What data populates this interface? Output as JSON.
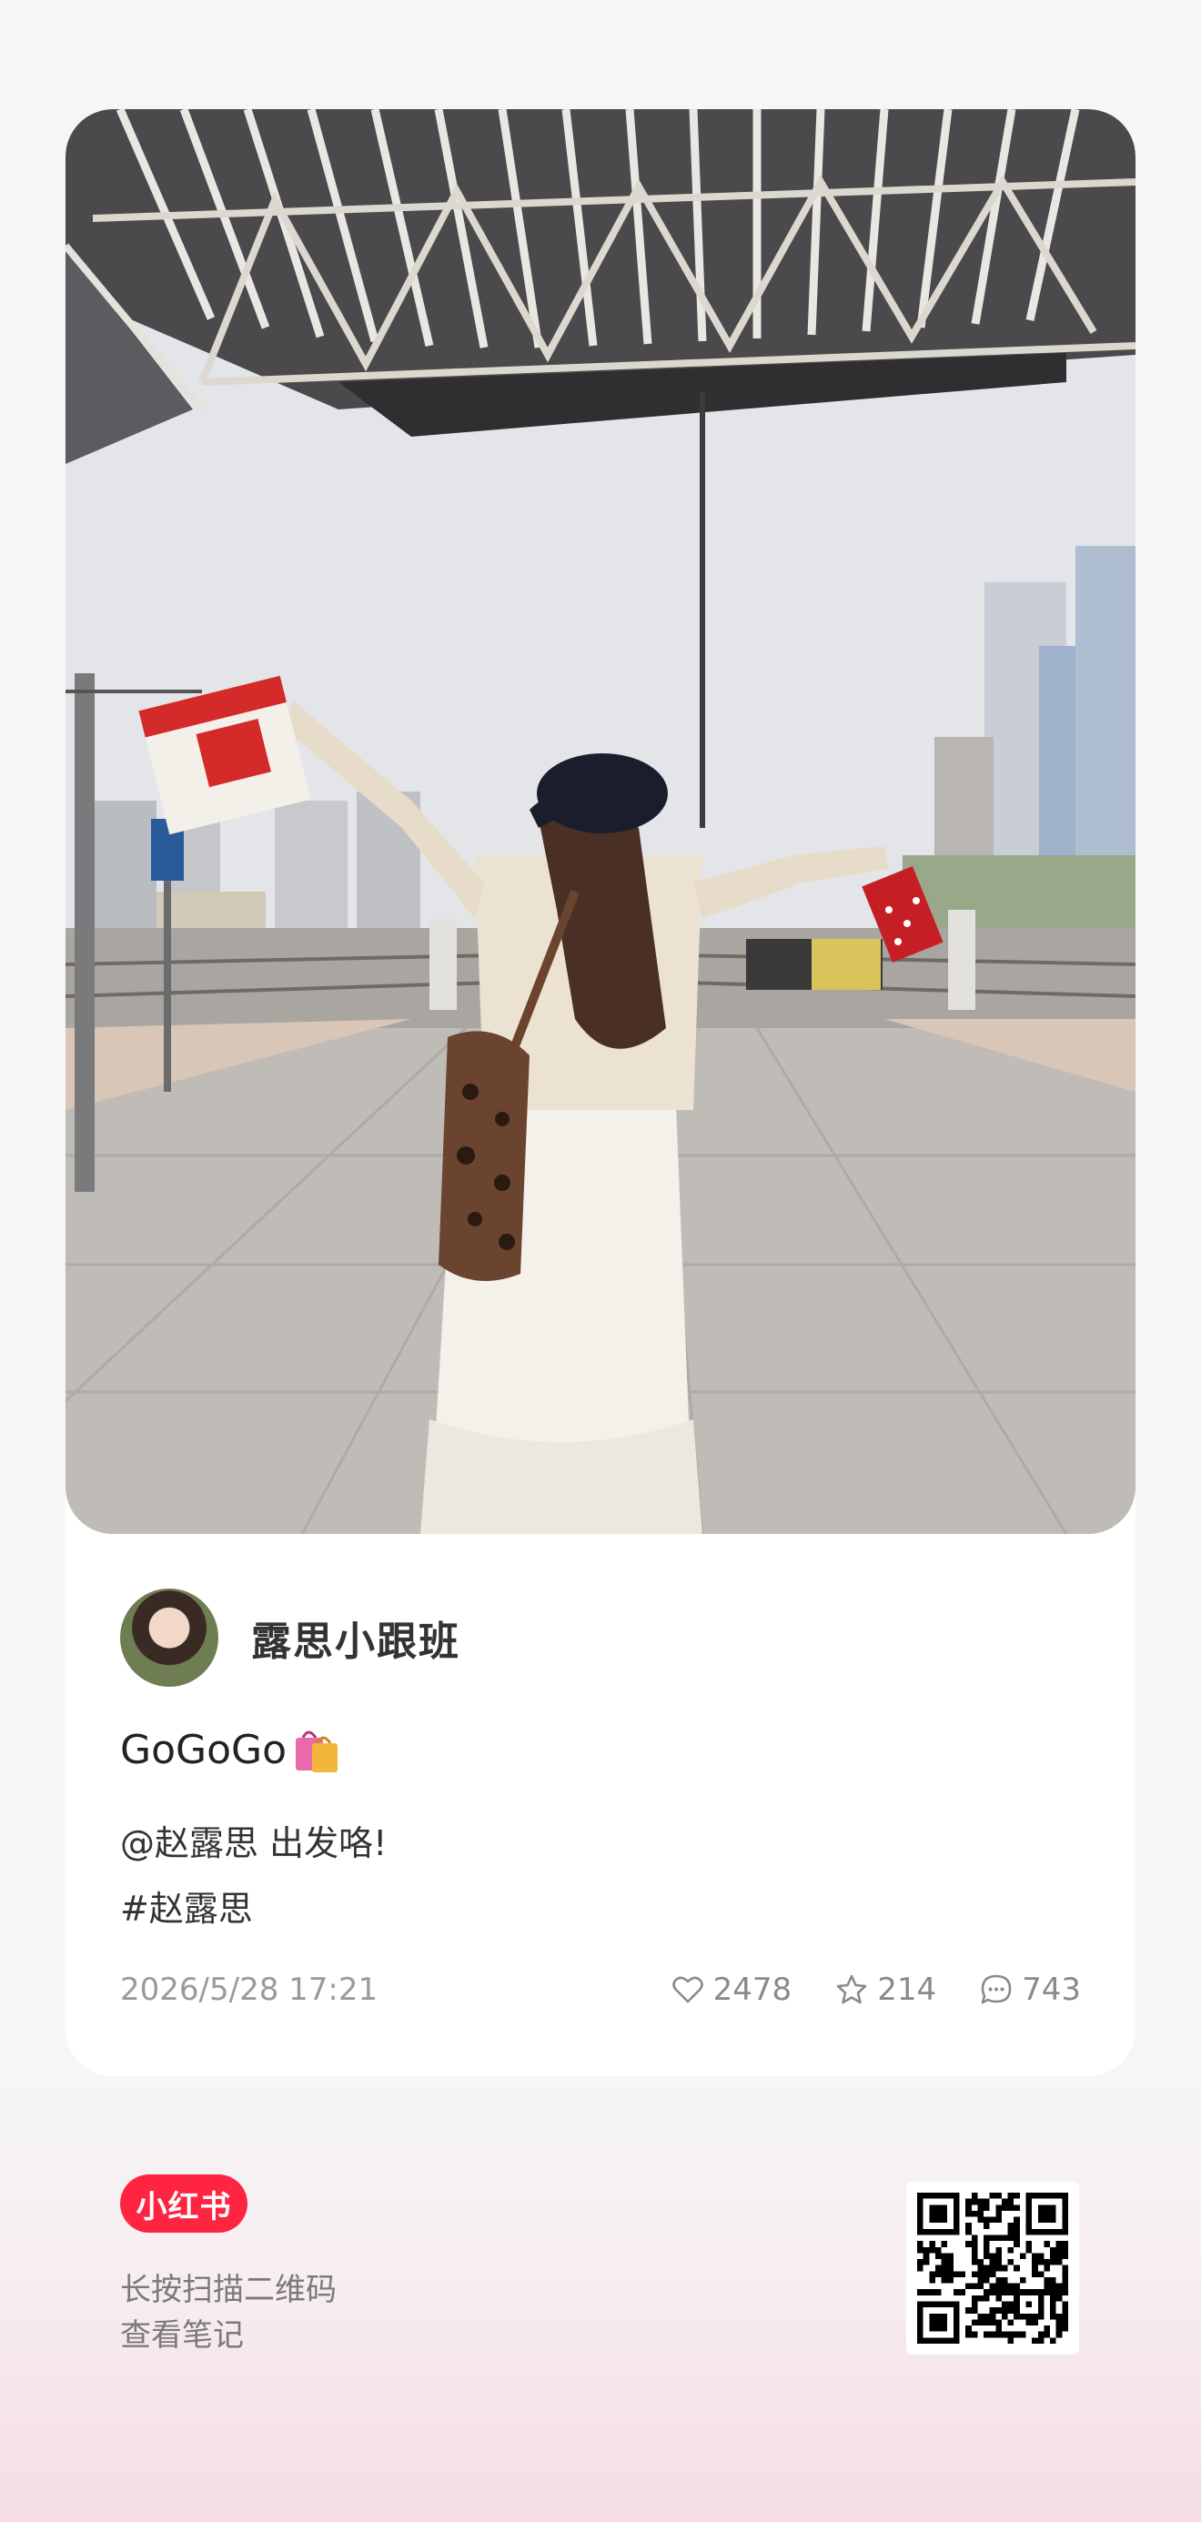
{
  "post": {
    "author_name": "露思小跟班",
    "title": "GoGoGo",
    "title_emoji_icon": "shopping-bags-icon",
    "body_lines": [
      "@赵露思 出发咯!",
      "#赵露思"
    ],
    "timestamp": "2026/5/28 17:21",
    "likes": "2478",
    "collects": "214",
    "comments": "743"
  },
  "footer": {
    "brand": "小红书",
    "scan_line1": "长按扫描二维码",
    "scan_line2": "查看笔记"
  },
  "colors": {
    "brand_red": "#ff2442",
    "background": "#f6f6f6",
    "card": "#ffffff",
    "muted_text": "#9a9a9a"
  },
  "icons": [
    "heart-icon",
    "star-icon",
    "comment-icon",
    "qr-code-icon",
    "shopping-bags-icon"
  ]
}
